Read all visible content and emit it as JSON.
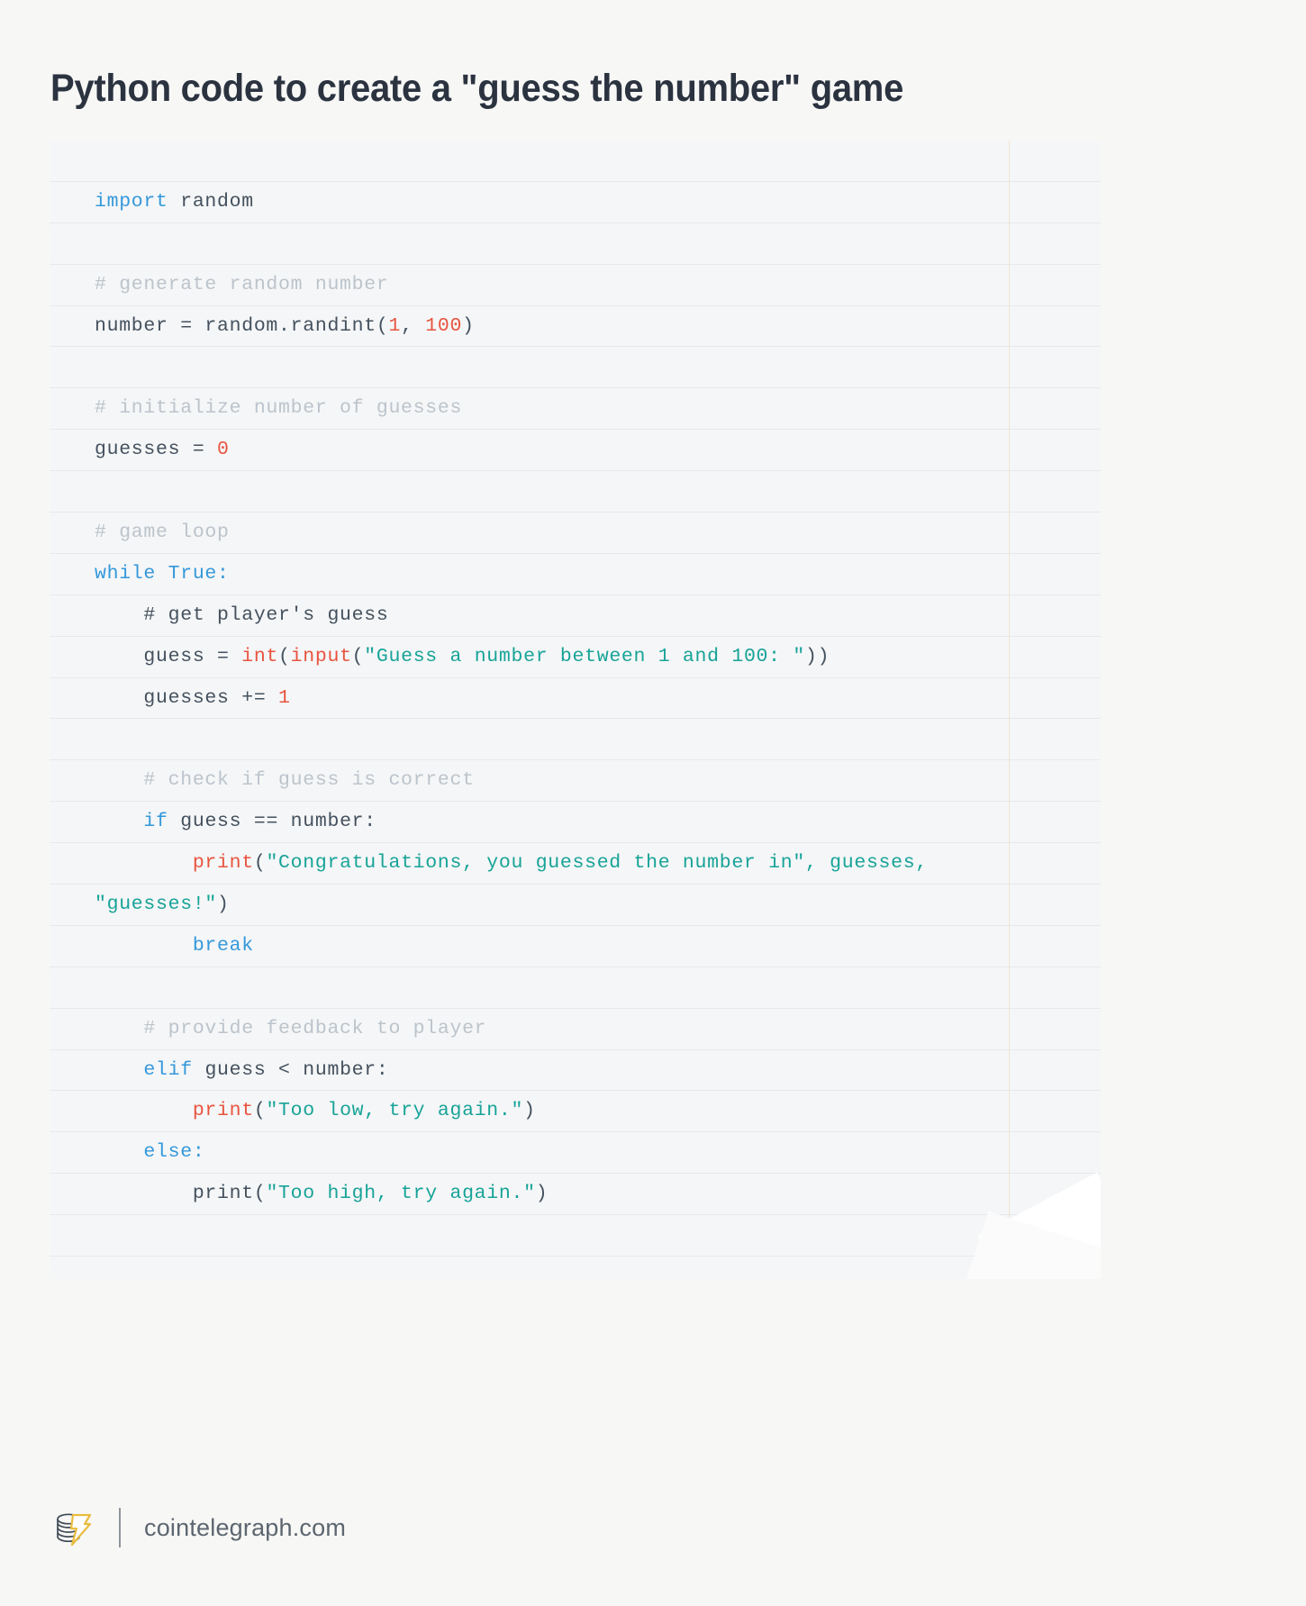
{
  "page": {
    "title": "Python code to create a \"guess the number\" game",
    "background_color": "#f7f7f5"
  },
  "code_block": {
    "language": "python",
    "background_color": "#f5f6f7",
    "row_separator_color": "#e6e9ec",
    "gutter_rule_color": "#f1e3d6",
    "syntax_colors": {
      "keyword": "#3498db",
      "builtin": "#e8543f",
      "string": "#17a398",
      "number": "#e8543f",
      "comment": "#bcc4cc",
      "plain": "#44515e"
    },
    "lines": [
      {
        "id": 0,
        "text": ""
      },
      {
        "id": 1,
        "text": "import random",
        "tokens": [
          {
            "t": "import",
            "c": "kw"
          },
          {
            "t": " random",
            "c": "pl"
          }
        ]
      },
      {
        "id": 2,
        "text": ""
      },
      {
        "id": 3,
        "text": "# generate random number",
        "tokens": [
          {
            "t": "# generate random number",
            "c": "com"
          }
        ]
      },
      {
        "id": 4,
        "text": "number = random.randint(1, 100)",
        "tokens": [
          {
            "t": "number = random.randint(",
            "c": "pl"
          },
          {
            "t": "1",
            "c": "num"
          },
          {
            "t": ", ",
            "c": "pl"
          },
          {
            "t": "100",
            "c": "num"
          },
          {
            "t": ")",
            "c": "pl"
          }
        ]
      },
      {
        "id": 5,
        "text": ""
      },
      {
        "id": 6,
        "text": "# initialize number of guesses",
        "tokens": [
          {
            "t": "# initialize number of guesses",
            "c": "com"
          }
        ]
      },
      {
        "id": 7,
        "text": "guesses = 0",
        "tokens": [
          {
            "t": "guesses = ",
            "c": "pl"
          },
          {
            "t": "0",
            "c": "num"
          }
        ]
      },
      {
        "id": 8,
        "text": ""
      },
      {
        "id": 9,
        "text": "# game loop",
        "tokens": [
          {
            "t": "# game loop",
            "c": "com"
          }
        ]
      },
      {
        "id": 10,
        "text": "while True:",
        "tokens": [
          {
            "t": "while",
            "c": "kw"
          },
          {
            "t": " ",
            "c": "pl"
          },
          {
            "t": "True",
            "c": "kw"
          },
          {
            "t": ":",
            "c": "kw"
          }
        ]
      },
      {
        "id": 11,
        "text": "    # get player's guess",
        "tokens": [
          {
            "t": "    # get player's guess",
            "c": "pl"
          }
        ]
      },
      {
        "id": 12,
        "text": "    guess = int(input(\"Guess a number between 1 and 100: \"))",
        "tokens": [
          {
            "t": "    guess = ",
            "c": "pl"
          },
          {
            "t": "int",
            "c": "bi"
          },
          {
            "t": "(",
            "c": "pl"
          },
          {
            "t": "input",
            "c": "bi"
          },
          {
            "t": "(",
            "c": "pl"
          },
          {
            "t": "\"Guess a number between 1 and 100: \"",
            "c": "str"
          },
          {
            "t": "))",
            "c": "pl"
          }
        ]
      },
      {
        "id": 13,
        "text": "    guesses += 1",
        "tokens": [
          {
            "t": "    guesses += ",
            "c": "pl"
          },
          {
            "t": "1",
            "c": "num"
          }
        ]
      },
      {
        "id": 14,
        "text": ""
      },
      {
        "id": 15,
        "text": "    # check if guess is correct",
        "tokens": [
          {
            "t": "    # check if guess is correct",
            "c": "com"
          }
        ]
      },
      {
        "id": 16,
        "text": "    if guess == number:",
        "tokens": [
          {
            "t": "    ",
            "c": "pl"
          },
          {
            "t": "if",
            "c": "kw"
          },
          {
            "t": " guess == number:",
            "c": "pl"
          }
        ]
      },
      {
        "id": 17,
        "text": "        print(\"Congratulations, you guessed the number in\", guesses,",
        "tokens": [
          {
            "t": "        ",
            "c": "pl"
          },
          {
            "t": "print",
            "c": "bi"
          },
          {
            "t": "(",
            "c": "pl"
          },
          {
            "t": "\"Congratulations, you guessed the number in\", guesses,",
            "c": "str"
          }
        ]
      },
      {
        "id": 18,
        "text": "\"guesses!\")",
        "wrapped": true,
        "tokens": [
          {
            "t": "\"guesses!\"",
            "c": "str"
          },
          {
            "t": ")",
            "c": "pl"
          }
        ]
      },
      {
        "id": 19,
        "text": "        break",
        "tokens": [
          {
            "t": "        ",
            "c": "pl"
          },
          {
            "t": "break",
            "c": "kw"
          }
        ]
      },
      {
        "id": 20,
        "text": ""
      },
      {
        "id": 21,
        "text": "    # provide feedback to player",
        "tokens": [
          {
            "t": "    # provide feedback to player",
            "c": "com"
          }
        ]
      },
      {
        "id": 22,
        "text": "    elif guess < number:",
        "tokens": [
          {
            "t": "    ",
            "c": "pl"
          },
          {
            "t": "elif",
            "c": "kw"
          },
          {
            "t": " guess < number:",
            "c": "pl"
          }
        ]
      },
      {
        "id": 23,
        "text": "        print(\"Too low, try again.\")",
        "tokens": [
          {
            "t": "        ",
            "c": "pl"
          },
          {
            "t": "print",
            "c": "bi"
          },
          {
            "t": "(",
            "c": "pl"
          },
          {
            "t": "\"Too low, try again.\"",
            "c": "str"
          },
          {
            "t": ")",
            "c": "pl"
          }
        ]
      },
      {
        "id": 24,
        "text": "    else:",
        "tokens": [
          {
            "t": "    ",
            "c": "pl"
          },
          {
            "t": "else:",
            "c": "kw"
          }
        ]
      },
      {
        "id": 25,
        "text": "        print(\"Too high, try again.\")",
        "tokens": [
          {
            "t": "        print(",
            "c": "pl"
          },
          {
            "t": "\"Too high, try again.\"",
            "c": "str"
          },
          {
            "t": ")",
            "c": "pl"
          }
        ]
      },
      {
        "id": 26,
        "text": ""
      },
      {
        "id": 27,
        "text": ""
      }
    ]
  },
  "footer": {
    "logo_name": "cointelegraph-coin-stack-bolt-logo",
    "logo_bolt_color": "#e8bc3e",
    "logo_coin_color": "#3f4a57",
    "site_label": "cointelegraph.com",
    "site_label_color": "#5d6670"
  }
}
